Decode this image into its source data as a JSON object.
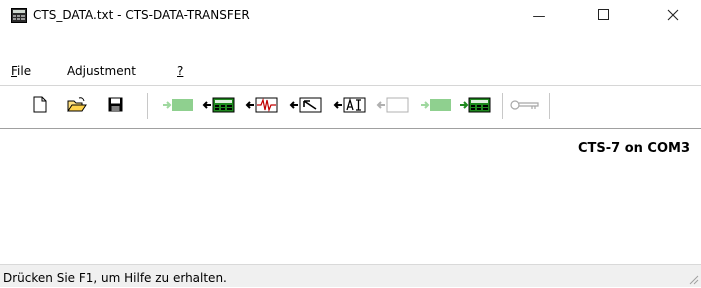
{
  "window": {
    "title": "CTS_DATA.txt - CTS-DATA-TRANSFER",
    "minimize_glyph": "—",
    "maximize_glyph": "☐",
    "close_glyph": "✕"
  },
  "menubar": {
    "file": {
      "mnemonic": "F",
      "rest": "ile"
    },
    "adjustment": "Adjustment",
    "help": "?"
  },
  "toolbar": {
    "icons": [
      "new-document-icon",
      "open-folder-icon",
      "save-disk-icon",
      "send-data-icon",
      "receive-data-icon",
      "signal-curve-icon",
      "cursor-arrow-icon",
      "analog-input-icon",
      "empty-display-icon",
      "transfer-device-icon",
      "transfer-data-icon",
      "key-icon"
    ]
  },
  "content": {
    "device_status": "CTS-7 on COM3"
  },
  "statusbar": {
    "text": "Drücken Sie F1, um Hilfe zu erhalten."
  },
  "colors": {
    "accent_green": "#1f8a1f",
    "disabled_green": "#8fd08f",
    "border": "#a0a0a0"
  }
}
